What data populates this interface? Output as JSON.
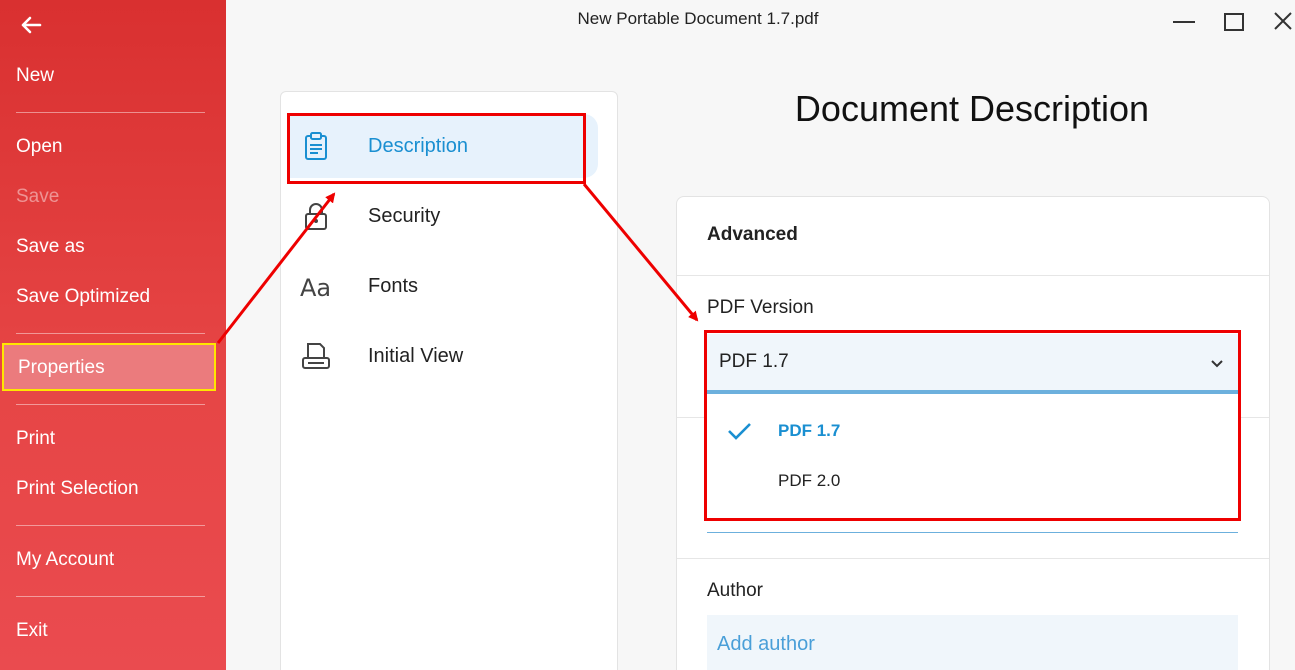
{
  "window": {
    "title": "New Portable Document 1.7.pdf"
  },
  "sidebar": {
    "items": [
      {
        "label": "New"
      },
      {
        "label": "Open"
      },
      {
        "label": "Save"
      },
      {
        "label": "Save as"
      },
      {
        "label": "Save Optimized"
      },
      {
        "label": "Properties"
      },
      {
        "label": "Print"
      },
      {
        "label": "Print Selection"
      },
      {
        "label": "My Account"
      },
      {
        "label": "Exit"
      }
    ]
  },
  "nav": {
    "items": [
      {
        "label": "Description",
        "icon": "clipboard-icon"
      },
      {
        "label": "Security",
        "icon": "lock-icon"
      },
      {
        "label": "Fonts",
        "icon": "font-icon"
      },
      {
        "label": "Initial View",
        "icon": "view-icon"
      }
    ]
  },
  "main": {
    "heading": "Document Description",
    "section_title": "Advanced",
    "pdf_version_label": "PDF Version",
    "pdf_version_value": "PDF 1.7",
    "options": [
      "PDF 1.7",
      "PDF 2.0"
    ],
    "author_label": "Author",
    "author_placeholder": "Add author"
  },
  "colors": {
    "sidebar": "#e03a3a",
    "accent": "#1a8fd1",
    "annotation": "#ee0000",
    "highlight": "#ffe600"
  }
}
